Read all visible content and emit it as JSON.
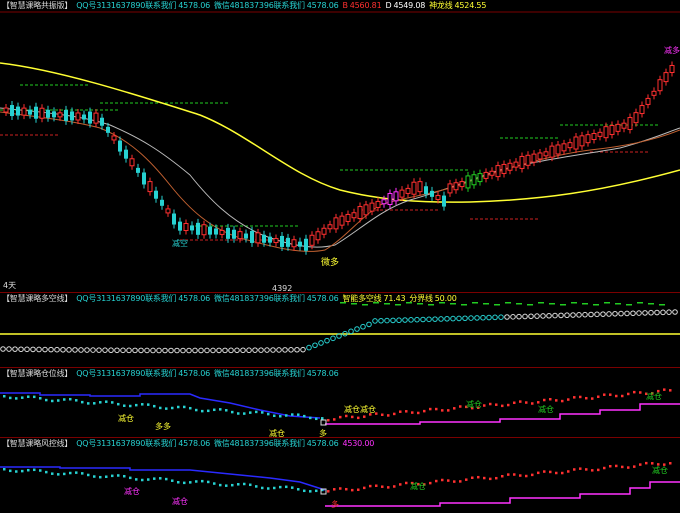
{
  "panels": {
    "main": {
      "title": "【智慧课略共振版】",
      "qq": "QQ号3131637890联系我们",
      "qq_val": "4578.06",
      "wx": "微信481837396联系我们",
      "wx_val": "4578.06",
      "b_label": "B",
      "b_val": "4560.81",
      "d_label": "D",
      "d_val": "4549.08",
      "shenlong_label": "神龙线",
      "shenlong_val": "4524.55",
      "marker_jian_duo": "减多",
      "marker_jian_kong": "减空",
      "marker_wei_duo": "微多",
      "low_price": "4392",
      "period": "4天"
    },
    "p2": {
      "title": "【智慧课略多空线】",
      "qq": "QQ号3131637890联系我们",
      "qq_val": "4578.06",
      "wx": "微信481837396联系我们",
      "wx_val": "4578.06",
      "dk_label": "智能多空线",
      "dk_val": "71.43",
      "fj_label": "分界线",
      "fj_val": "50.00"
    },
    "p3": {
      "title": "【智慧课略仓位线】",
      "qq": "QQ号3131637890联系我们",
      "qq_val": "4578.06",
      "wx": "微信481837396联系我们",
      "wx_val": "4578.06",
      "m_jiancang1": "减仓",
      "m_shuangduo": "多多",
      "m_jiancang2": "减仓",
      "m_duo": "多",
      "m_jiancang_jiancang": "减仓减仓",
      "m_jiancang3": "减仓",
      "m_jiancang4": "减仓",
      "m_jiancang5": "减仓"
    },
    "p4": {
      "title": "【智慧课略风控线】",
      "qq": "QQ号3131637890联系我们",
      "qq_val": "4578.06",
      "wx": "微信481837396联系我们",
      "wx_val": "4578.06",
      "extra_val": "4530.00",
      "m_jiancang1": "减仓",
      "m_jiancang2": "减仓",
      "m_duo": "多",
      "m_jiancang3": "减仓",
      "m_jiancang4": "减仓"
    }
  },
  "colors": {
    "title": "#e8e8e8",
    "cyan": "#27d2d2",
    "red": "#ff3030",
    "magenta": "#ff33ff",
    "yellow": "#ffff33",
    "white": "#ffffff",
    "green": "#22cc22",
    "blue": "#2a2aff"
  }
}
